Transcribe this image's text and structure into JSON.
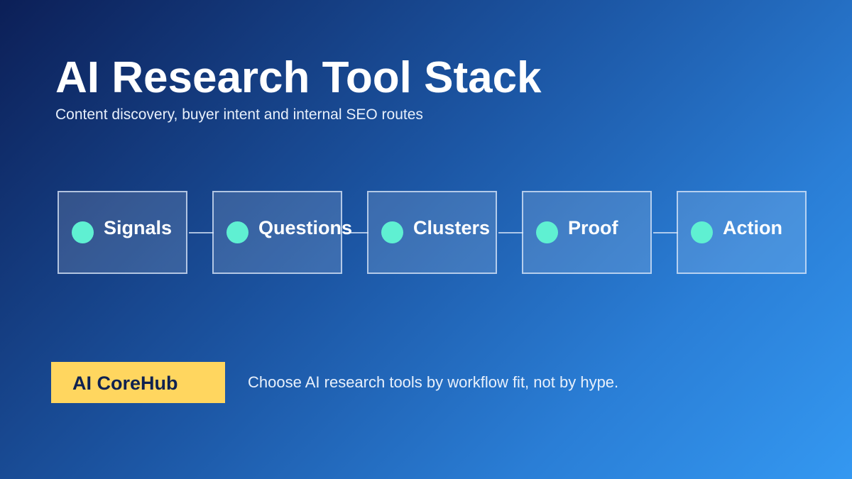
{
  "header": {
    "title": "AI Research Tool Stack",
    "subtitle": "Content discovery, buyer intent and internal SEO routes"
  },
  "flow": {
    "steps": [
      {
        "label": "Signals"
      },
      {
        "label": "Questions"
      },
      {
        "label": "Clusters"
      },
      {
        "label": "Proof"
      },
      {
        "label": "Action"
      }
    ]
  },
  "footer": {
    "badge_label": "AI CoreHub",
    "tagline": "Choose AI research tools by workflow fit, not by hype."
  },
  "colors": {
    "accent_dot": "#5ff0d2",
    "badge_bg": "#ffd65f",
    "badge_text": "#0f2150",
    "background_start": "#0c1f57",
    "background_end": "#3498f1"
  }
}
